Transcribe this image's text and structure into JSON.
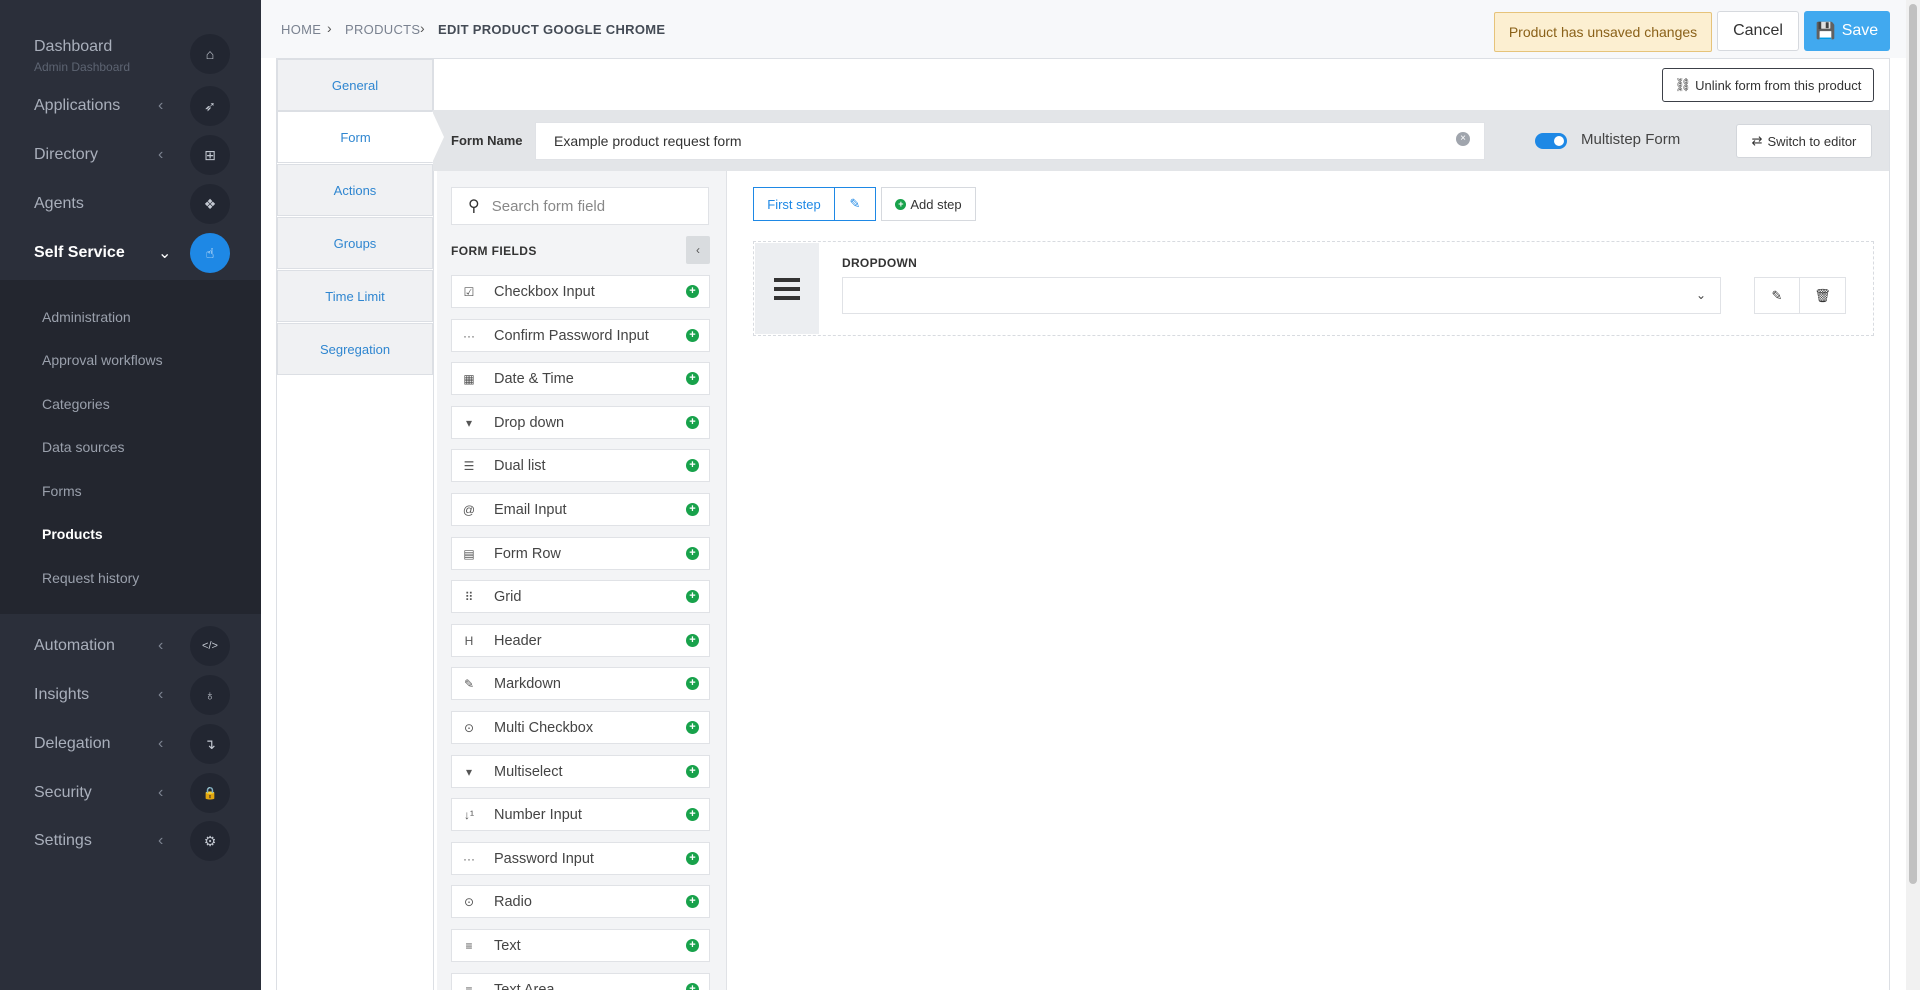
{
  "sidebar": {
    "items": [
      {
        "label": "Dashboard",
        "sublabel": "Admin Dashboard",
        "icon": "home-icon",
        "glyph": "⌂"
      },
      {
        "label": "Applications",
        "icon": "rocket-icon",
        "glyph": "➶"
      },
      {
        "label": "Directory",
        "icon": "sitemap-icon",
        "glyph": "⊞"
      },
      {
        "label": "Agents",
        "icon": "cubes-icon",
        "glyph": "❖"
      },
      {
        "label": "Self Service",
        "icon": "hand-pointer-icon",
        "glyph": "☝"
      },
      {
        "label": "Automation",
        "icon": "code-icon",
        "glyph": "</>"
      },
      {
        "label": "Insights",
        "icon": "lightbulb-icon",
        "glyph": "♁"
      },
      {
        "label": "Delegation",
        "icon": "level-down-icon",
        "glyph": "↴"
      },
      {
        "label": "Security",
        "icon": "lock-icon",
        "glyph": "🔒"
      },
      {
        "label": "Settings",
        "icon": "gear-icon",
        "glyph": "⚙"
      }
    ],
    "submenu": [
      "Administration",
      "Approval workflows",
      "Categories",
      "Data sources",
      "Forms",
      "Products",
      "Request history"
    ]
  },
  "breadcrumb": {
    "home": "HOME",
    "products": "PRODUCTS",
    "current": "EDIT PRODUCT GOOGLE CHROME"
  },
  "header": {
    "unsaved": "Product has unsaved changes",
    "cancel": "Cancel",
    "save": "Save"
  },
  "tabs": [
    "General",
    "Form",
    "Actions",
    "Groups",
    "Time Limit",
    "Segregation"
  ],
  "form": {
    "unlink": "Unlink form from this product",
    "name_label": "Form Name",
    "name_value": "Example product request form",
    "multistep_label": "Multistep Form",
    "switch_editor": "Switch to editor"
  },
  "fields_panel": {
    "search_placeholder": "Search form field",
    "title": "FORM FIELDS",
    "fields": [
      {
        "name": "Checkbox Input",
        "icon": "check-square-icon",
        "glyph": "☑"
      },
      {
        "name": "Confirm Password Input",
        "icon": "ellipsis-icon",
        "glyph": "···"
      },
      {
        "name": "Date & Time",
        "icon": "calendar-icon",
        "glyph": "▦"
      },
      {
        "name": "Drop down",
        "icon": "caret-square-icon",
        "glyph": "▾"
      },
      {
        "name": "Dual list",
        "icon": "list-icon",
        "glyph": "☰"
      },
      {
        "name": "Email Input",
        "icon": "at-icon",
        "glyph": "@"
      },
      {
        "name": "Form Row",
        "icon": "table-icon",
        "glyph": "▤"
      },
      {
        "name": "Grid",
        "icon": "th-icon",
        "glyph": "⠿"
      },
      {
        "name": "Header",
        "icon": "heading-icon",
        "glyph": "H"
      },
      {
        "name": "Markdown",
        "icon": "edit-icon",
        "glyph": "✎"
      },
      {
        "name": "Multi Checkbox",
        "icon": "check-circle-icon",
        "glyph": "⊙"
      },
      {
        "name": "Multiselect",
        "icon": "caret-square-icon",
        "glyph": "▾"
      },
      {
        "name": "Number Input",
        "icon": "sort-numeric-icon",
        "glyph": "↓¹"
      },
      {
        "name": "Password Input",
        "icon": "ellipsis-icon",
        "glyph": "···"
      },
      {
        "name": "Radio",
        "icon": "dot-circle-icon",
        "glyph": "⊙"
      },
      {
        "name": "Text",
        "icon": "align-left-icon",
        "glyph": "≡"
      },
      {
        "name": "Text Area",
        "icon": "align-left-icon",
        "glyph": "≡"
      }
    ]
  },
  "steps": {
    "first": "First step",
    "add": "Add step"
  },
  "dropdown_field": {
    "title": "DROPDOWN"
  },
  "colors": {
    "sidebar_bg": "#2b2f3a",
    "accent": "#1e88e5",
    "save_button": "#41a9ef",
    "add_green": "#18a24b",
    "warning_bg": "#fcefd1"
  }
}
